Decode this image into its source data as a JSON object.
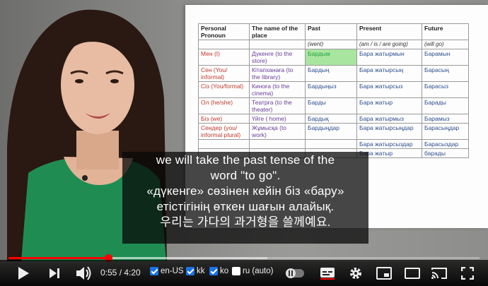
{
  "table": {
    "headers": [
      "Personal Pronoun",
      "The name of the place",
      "Past",
      "Present",
      "Future"
    ],
    "subheaders": [
      "",
      "",
      "(went)",
      "(am / is / are going)",
      "(will go)"
    ],
    "rows": [
      {
        "pronoun": "Мен (I)",
        "place": "Дүкенге (to the store)",
        "past": "Бардым",
        "present": "Бара жатырмын",
        "future": "Барамын"
      },
      {
        "pronoun": "Сен (You/ informal)",
        "place": "Кітапханаға (to the library)",
        "past": "Бардың",
        "present": "Бара жатырсың",
        "future": "Барасың"
      },
      {
        "pronoun": "Сіз (You/formal)",
        "place": "Киноға (to the cinema)",
        "past": "Бардыңыз",
        "present": "Бара жатырсыз",
        "future": "Барасыз"
      },
      {
        "pronoun": "Ол (he/she)",
        "place": "Театрға (to the theater)",
        "past": "Барды",
        "present": "Бара жатыр",
        "future": "Барады"
      },
      {
        "pronoun": "Біз (we)",
        "place": "Үйге ( home)",
        "past": "Бардық",
        "present": "Бара жатырмыз",
        "future": "Барамыз"
      },
      {
        "pronoun": "Сендер (you/ informal plural)",
        "place": "Жұмысқа (to work)",
        "past": "Бардыңдар",
        "present": "Бара жатырсыңдар",
        "future": "Барасыңдар"
      },
      {
        "pronoun": "",
        "place": "",
        "past": "",
        "present": "Бара жатырсыздар",
        "future": "Барасыздар"
      },
      {
        "pronoun": "",
        "place": "",
        "past": "",
        "present": "Бара жатыр",
        "future": "барады"
      }
    ]
  },
  "subtitles": {
    "en": [
      "we will take the past tense of the",
      "word \"to go\"."
    ],
    "kk": [
      "«дүкенге» сөзінен кейін біз «бару»",
      "етістігінің өткен шағын алайық."
    ],
    "ko": [
      "우리는 가다의 과거형을 쓸께예요."
    ]
  },
  "player": {
    "time_display": "0:55 / 4:20",
    "played_fraction": 0.211,
    "loaded_fraction": 0.55,
    "captions": [
      {
        "label": "en-US",
        "checked": true
      },
      {
        "label": "kk",
        "checked": true
      },
      {
        "label": "ko",
        "checked": true
      },
      {
        "label": "ru (auto)",
        "checked": false
      }
    ],
    "accent_color": "#ff0000"
  }
}
